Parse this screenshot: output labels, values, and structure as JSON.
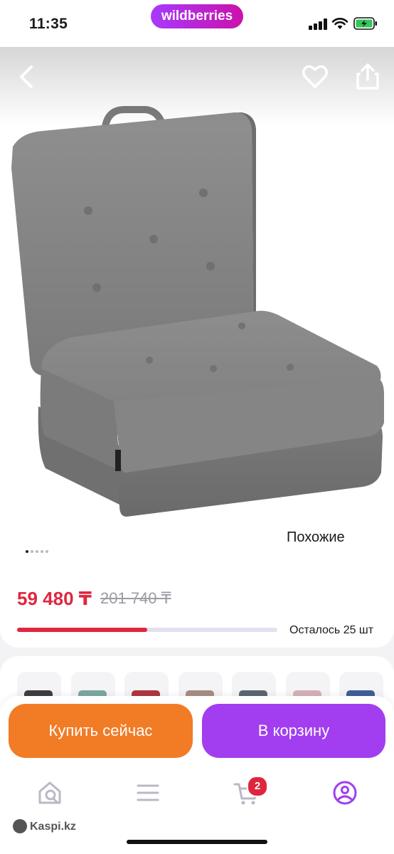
{
  "status_bar": {
    "time": "11:35",
    "brand": "wildberries"
  },
  "gallery": {
    "similar_label": "Похожие",
    "slide_count": 5,
    "active_slide": 1
  },
  "price": {
    "current": "59 480 ₸",
    "old": "201 740 ₸",
    "stock_text": "Осталось 25 шт",
    "stock_fill_fraction": 0.5
  },
  "variants": [
    {
      "color": "#2a2a2c"
    },
    {
      "color": "#6f9e97"
    },
    {
      "color": "#a8222b"
    },
    {
      "color": "#9d8474"
    },
    {
      "color": "#4b5663"
    },
    {
      "color": "#d3a9b1"
    },
    {
      "color": "#2f4e8f"
    }
  ],
  "actions": {
    "buy_label": "Купить сейчас",
    "cart_label": "В корзину"
  },
  "tabbar": {
    "cart_badge": "2",
    "watermark": "Kaspi.kz"
  },
  "colors": {
    "accent_purple": "#a23ef0",
    "accent_orange": "#f27b26",
    "price_red": "#e0263f"
  }
}
